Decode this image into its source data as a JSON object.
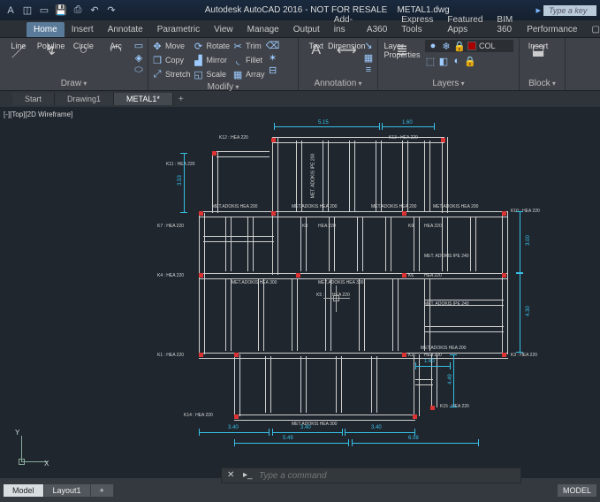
{
  "app": {
    "title": "Autodesk AutoCAD 2016 - NOT FOR RESALE",
    "filename": "METAL1.dwg",
    "search_placeholder": "Type a key"
  },
  "ribbon_tabs": [
    "Home",
    "Insert",
    "Annotate",
    "Parametric",
    "View",
    "Manage",
    "Output",
    "Add-ins",
    "A360",
    "Express Tools",
    "Featured Apps",
    "BIM 360",
    "Performance"
  ],
  "active_tab": "Home",
  "panels": {
    "draw": {
      "label": "Draw",
      "line": "Line",
      "polyline": "Polyline",
      "circle": "Circle",
      "arc": "Arc"
    },
    "modify": {
      "label": "Modify",
      "move": "Move",
      "copy": "Copy",
      "stretch": "Stretch",
      "rotate": "Rotate",
      "scale": "Scale",
      "array": "Array",
      "trim": "Trim",
      "fillet": "Fillet"
    },
    "annotation": {
      "label": "Annotation",
      "text": "Text",
      "dimension": "Dimension"
    },
    "layers": {
      "label": "Layers",
      "layer_props": "Layer\nProperties",
      "current": "COL"
    },
    "block": {
      "label": "Block",
      "insert": "Insert"
    }
  },
  "doc_tabs": [
    "Start",
    "Drawing1",
    "METAL1*"
  ],
  "active_doc": "METAL1*",
  "viewport_state": "[-][Top][2D Wireframe]",
  "ucs": {
    "y": "Y",
    "x": "X"
  },
  "cmd": {
    "placeholder": "Type a command"
  },
  "bottom_tabs": [
    "Model",
    "Layout1"
  ],
  "active_bottom": "Model",
  "status_mode": "MODEL",
  "beam_labels": {
    "k12": "K12 : HEA 220",
    "k13": "K13 : HEA 220",
    "k11": "K11 : HEA 220",
    "k7": "K7 : HEA 220",
    "k8": "K8",
    "k8b": "HEA 220",
    "k9": "K9",
    "k9b": "HEA 220",
    "k10": "K10 : HEA 220",
    "k4": "K4 : HEA 220",
    "k5": "K5 :",
    "k5b": "HEA 220",
    "k6": "K6",
    "k6b": "HEA 220",
    "k1": "K1 : HEA 220",
    "k2": "K2 :",
    "k2b": "HEA 200",
    "k3": "K3 : HEA 220",
    "k14": "K14 : HEA 220",
    "k15": "K15 : HEA 220",
    "ipe200": "MET. ADOKIS IPE 200",
    "ipe300": "MET.ADOKIS IPE 300",
    "ipe240": "MET. ADOKIS IPE 240",
    "hea200": "MET.ADOKIS HEA 200",
    "hea300": "MET.ADOKIS HEA 300",
    "hea220": "MET. ADOKIS HEA 220"
  },
  "dims": {
    "d515": "5.15",
    "d160": "1.60",
    "d353": "3.53",
    "d608": "6.08",
    "d340": "3.40",
    "d430": "4.30",
    "d160b": "1.60",
    "d300": "3.00",
    "d549": "5.49",
    "d449": "4.49"
  }
}
